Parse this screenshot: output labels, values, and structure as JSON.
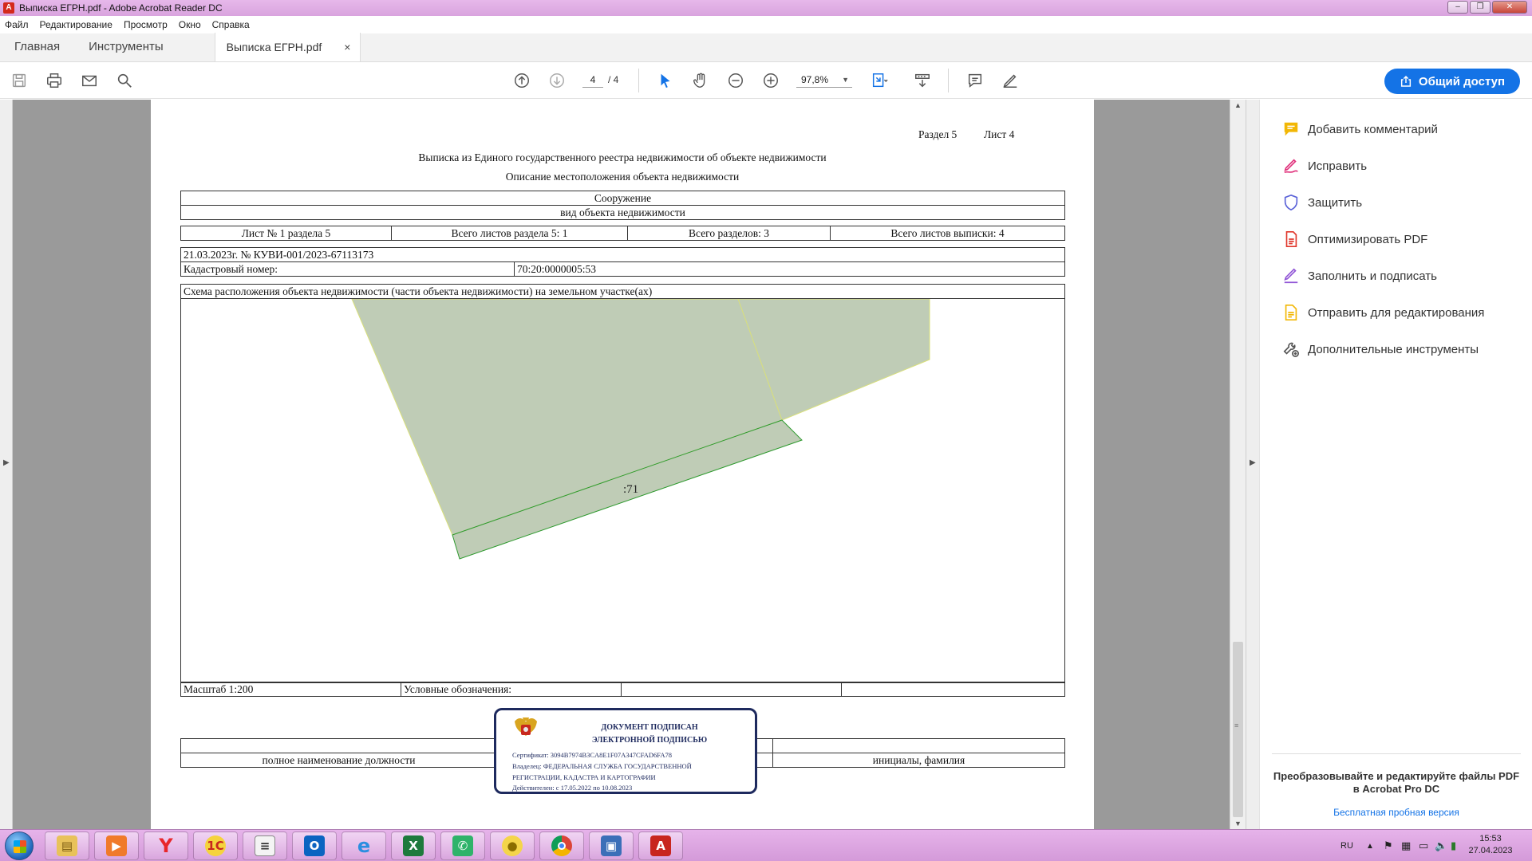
{
  "window": {
    "title": "Выписка ЕГРН.pdf - Adobe Acrobat Reader DC",
    "controls": {
      "minimize": "–",
      "maximize": "❐",
      "close": "✕"
    }
  },
  "menu": [
    "Файл",
    "Редактирование",
    "Просмотр",
    "Окно",
    "Справка"
  ],
  "tabs": {
    "home": "Главная",
    "tools": "Инструменты",
    "document": "Выписка ЕГРН.pdf",
    "close": "×"
  },
  "toolbar": {
    "page_current": "4",
    "page_total": "/  4",
    "zoom": "97,8%",
    "share_label": "Общий доступ",
    "icons": [
      "save-icon",
      "print-icon",
      "mail-icon",
      "search-icon",
      "page-up-icon",
      "page-down-icon",
      "select-arrow-icon",
      "hand-icon",
      "zoom-out-icon",
      "zoom-in-icon",
      "fit-page-icon",
      "scroll-mode-icon",
      "comment-icon",
      "pen-icon"
    ]
  },
  "document": {
    "section": "Раздел 5",
    "sheet": "Лист 4",
    "heading1": "Выписка из Единого государственного реестра недвижимости об объекте недвижимости",
    "heading2": "Описание местоположения объекта недвижимости",
    "object_type": "Сооружение",
    "object_type_caption": "вид объекта недвижимости",
    "sheet_info": [
      "Лист № 1 раздела 5",
      "Всего листов раздела 5: 1",
      "Всего разделов: 3",
      "Всего листов выписки: 4"
    ],
    "date_number": "21.03.2023г. № КУВИ-001/2023-67113173",
    "cadastral_label": "Кадастровый номер:",
    "cadastral_value": "70:20:0000005:53",
    "scheme_title": "Схема расположения объекта недвижимости (части объекта недвижимости) на земельном участке(ах)",
    "parcel_label": ":71",
    "scale": "Масштаб 1:200",
    "legend": "Условные обозначения:",
    "position_caption": "полное наименование должности",
    "initials_caption": "инициалы, фамилия"
  },
  "stamp": {
    "title_line1": "ДОКУМЕНТ ПОДПИСАН",
    "title_line2": "ЭЛЕКТРОННОЙ ПОДПИСЬЮ",
    "certificate": "Сертификат: 3094B7974B3CA8E1F07A347CFAD6FA78",
    "owner_line1": "Владелец: ФЕДЕРАЛЬНАЯ СЛУЖБА ГОСУДАРСТВЕННОЙ",
    "owner_line2": "РЕГИСТРАЦИИ, КАДАСТРА И КАРТОГРАФИИ",
    "valid": "Действителен: с 17.05.2022 по 10.08.2023"
  },
  "right_panel": {
    "items": [
      {
        "label": "Добавить комментарий",
        "icon": "comment-add-icon",
        "color": "#f2b705"
      },
      {
        "label": "Исправить",
        "icon": "edit-icon",
        "color": "#e0327c"
      },
      {
        "label": "Защитить",
        "icon": "shield-icon",
        "color": "#5b63d8"
      },
      {
        "label": "Оптимизировать PDF",
        "icon": "pdf-optimize-icon",
        "color": "#e0362b"
      },
      {
        "label": "Заполнить и подписать",
        "icon": "fill-sign-icon",
        "color": "#9055d6"
      },
      {
        "label": "Отправить для редактирования",
        "icon": "send-review-icon",
        "color": "#f2b705"
      },
      {
        "label": "Дополнительные инструменты",
        "icon": "more-tools-icon",
        "color": "#555555"
      }
    ],
    "promo_line1": "Преобразовывайте и редактируйте файлы PDF",
    "promo_line2": "в Acrobat Pro DC",
    "promo_link": "Бесплатная пробная версия"
  },
  "taskbar": {
    "apps": [
      "explorer-icon",
      "media-icon",
      "yandex-icon",
      "1c-icon",
      "notepad-icon",
      "outlook-icon",
      "ie-icon",
      "excel-icon",
      "messenger-icon",
      "sticky-icon",
      "chrome-icon",
      "network-icon",
      "acrobat-icon"
    ],
    "language": "RU",
    "time": "15:53",
    "date": "27.04.2023"
  },
  "colors": {
    "accent": "#1473e6",
    "parcel_fill": "#bfccb6",
    "parcel_stroke": "#2e9a2e"
  }
}
